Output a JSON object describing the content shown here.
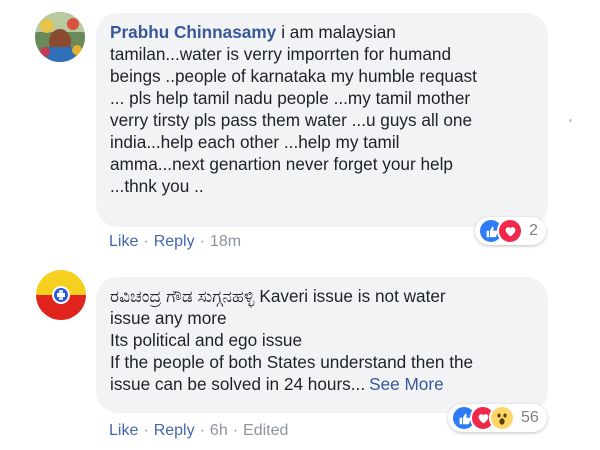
{
  "comments": [
    {
      "author": "Prabhu Chinnasamy",
      "text_lines": [
        "i am malaysian",
        "tamilan...water is verry imporrten for humand",
        "beings ..people of karnataka my humble requast",
        "... pls help tamil nadu people ...my tamil mother",
        "verry tirsty pls pass them water ...u guys all one",
        "india...help each other ...help my tamil",
        "amma...next genartion never forget your help",
        "...thnk you .."
      ],
      "actions": {
        "like": "Like",
        "reply": "Reply",
        "sep": "·",
        "time": "18m"
      },
      "reactions": {
        "types": [
          "like-icon",
          "love-icon"
        ],
        "count": "2"
      }
    },
    {
      "author": "ರವಿಚಂದ್ರ ಗೌಡ ಸುಗ್ಗನಹಳ್ಳಿ",
      "text_lines": [
        "Kaveri issue is not water",
        "issue any more",
        "Its political and ego issue",
        "If the people of both States understand then the",
        "issue can be solved in 24 hours..."
      ],
      "see_more": "See More",
      "actions": {
        "like": "Like",
        "reply": "Reply",
        "sep": "·",
        "time": "6h",
        "edited": "Edited"
      },
      "reactions": {
        "types": [
          "like-icon",
          "love-icon",
          "wow-icon"
        ],
        "count": "56"
      }
    }
  ],
  "colors": {
    "bubble": "#f2f3f5",
    "author_link": "#385898",
    "action_link": "#4267b2",
    "meta_text": "#90949c",
    "like_blue": "#2e7bf6",
    "love_red": "#f0284a",
    "wow_yellow": "#fcd667"
  }
}
